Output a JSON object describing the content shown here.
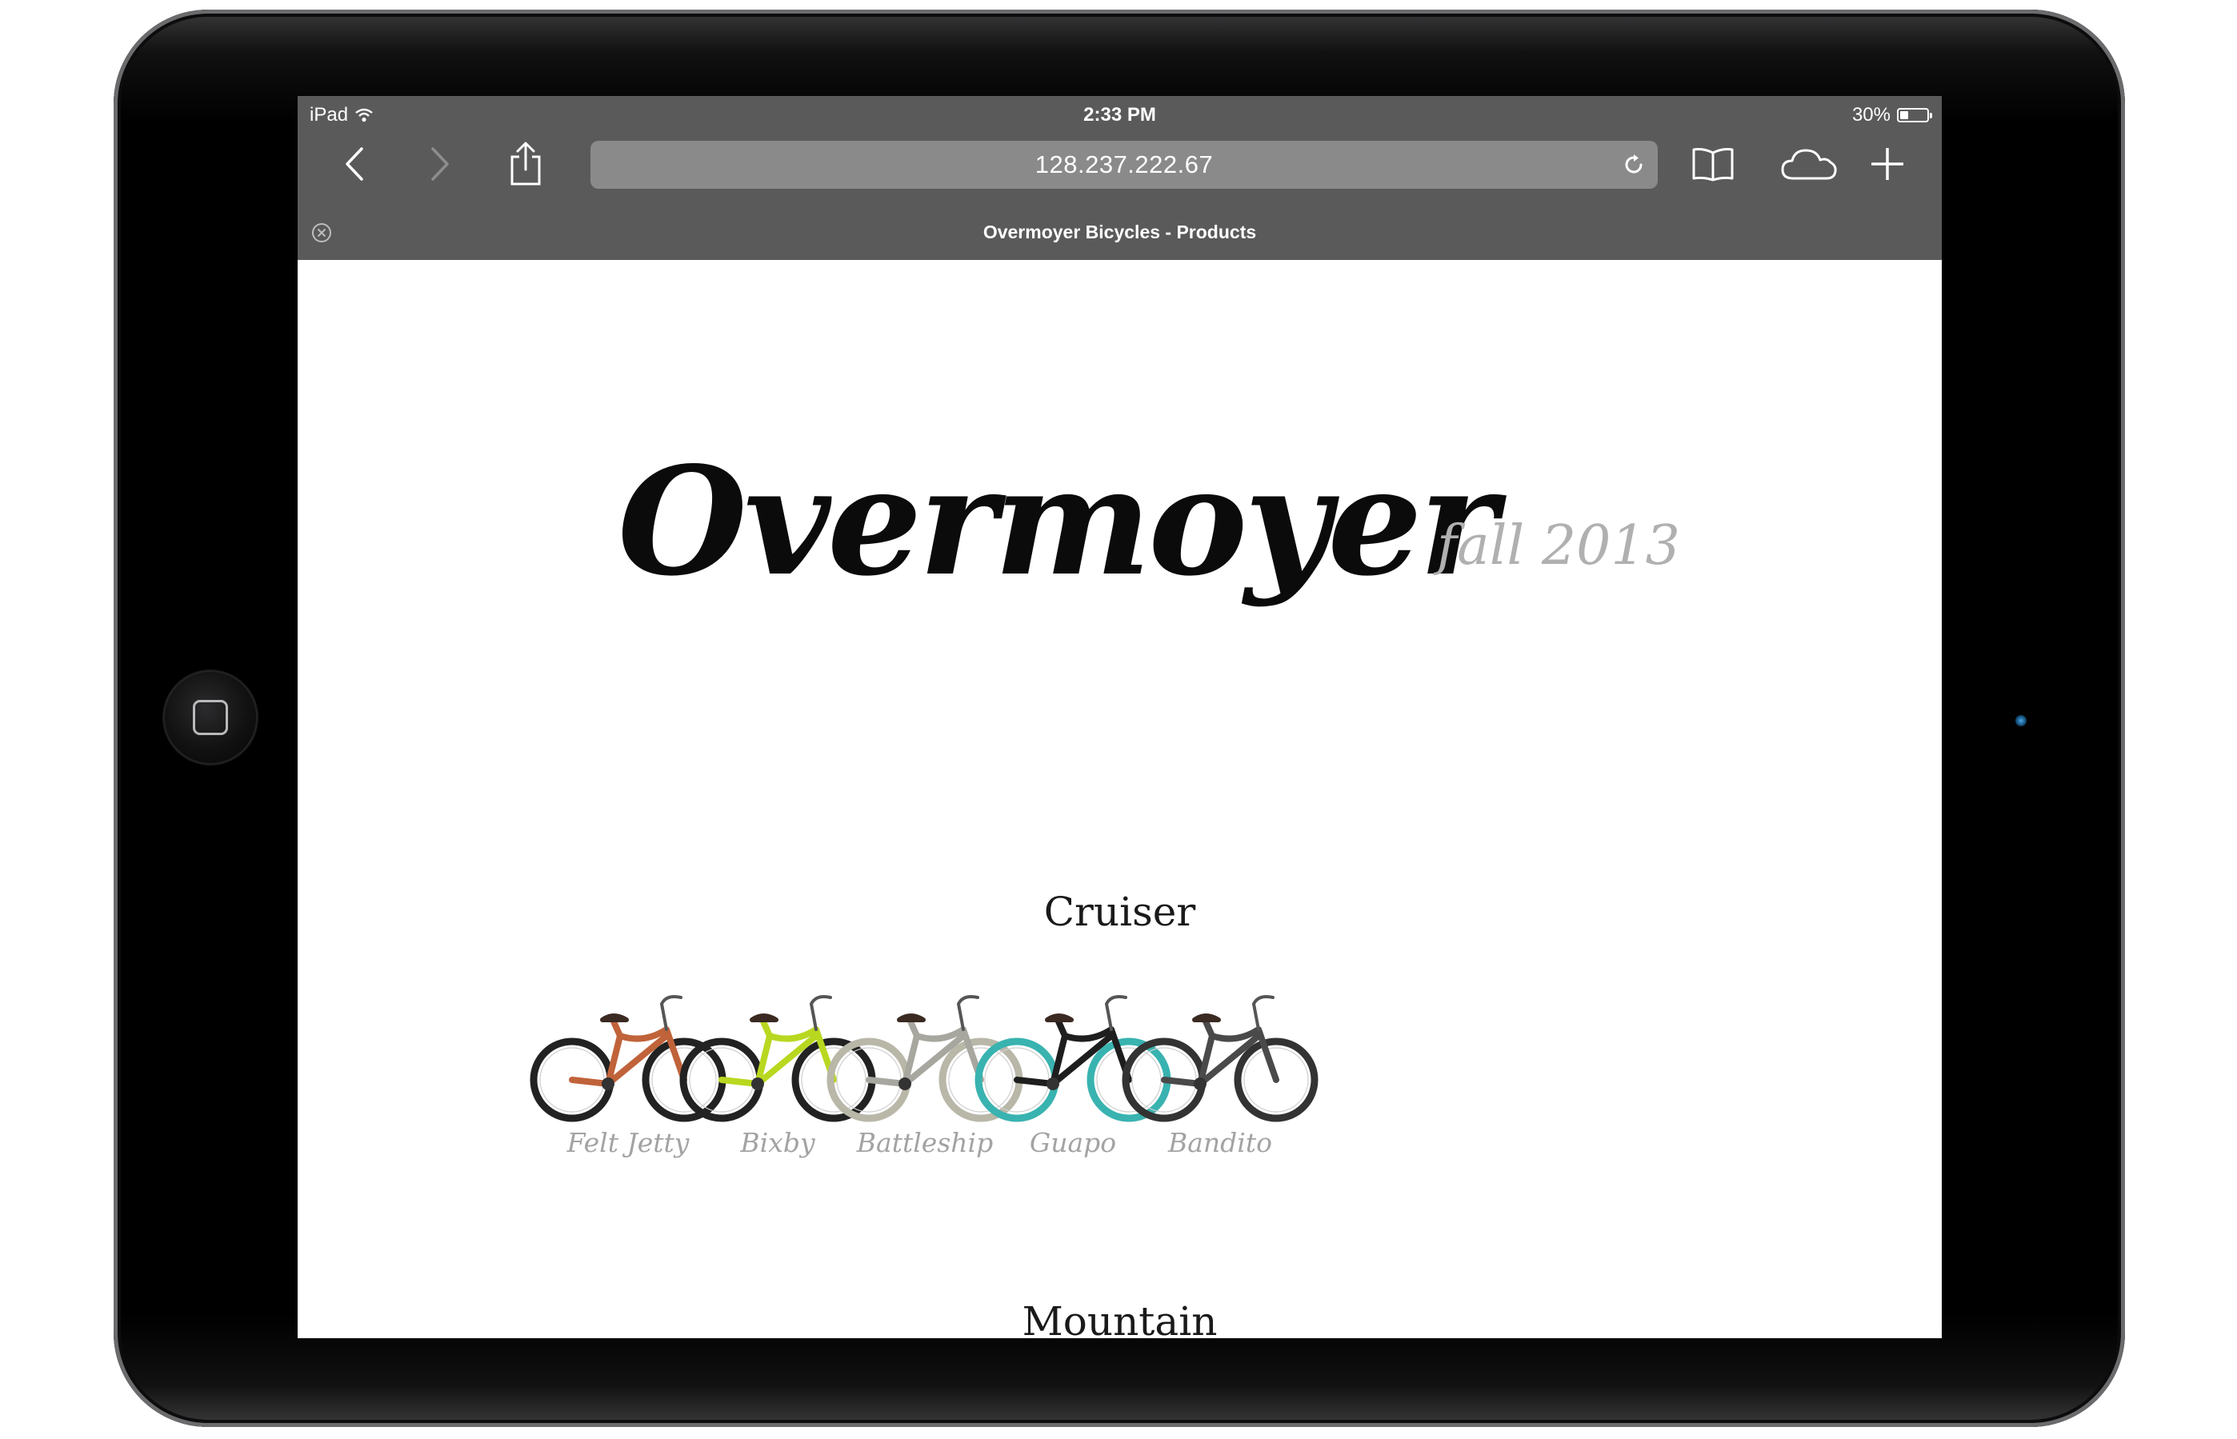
{
  "status_bar": {
    "device": "iPad",
    "time": "2:33 PM",
    "battery": "30%",
    "battery_level": 0.3
  },
  "browser": {
    "url": "128.237.222.67",
    "tab_title": "Overmoyer Bicycles - Products",
    "buttons": [
      "back-icon",
      "forward-icon",
      "share-icon",
      "reload-icon",
      "bookmarks-icon",
      "icloud-tabs-icon",
      "new-tab-icon",
      "close-tab-icon"
    ]
  },
  "page": {
    "logo": "Overmoyer",
    "season": "fall 2013",
    "sections": [
      {
        "title": "Cruiser",
        "bikes": [
          {
            "name": "Felt Jetty",
            "frame_color": "#c0633a",
            "tire_color": "#222222"
          },
          {
            "name": "Bixby",
            "frame_color": "#b8d820",
            "tire_color": "#222222"
          },
          {
            "name": "Battleship",
            "frame_color": "#a7a7a0",
            "tire_color": "#b9b7a8"
          },
          {
            "name": "Guapo",
            "frame_color": "#1e1e1e",
            "tire_color": "#39b3b0"
          },
          {
            "name": "Bandito",
            "frame_color": "#4a4a4a",
            "tire_color": "#333333"
          }
        ]
      },
      {
        "title": "Mountain",
        "bikes": []
      }
    ]
  }
}
